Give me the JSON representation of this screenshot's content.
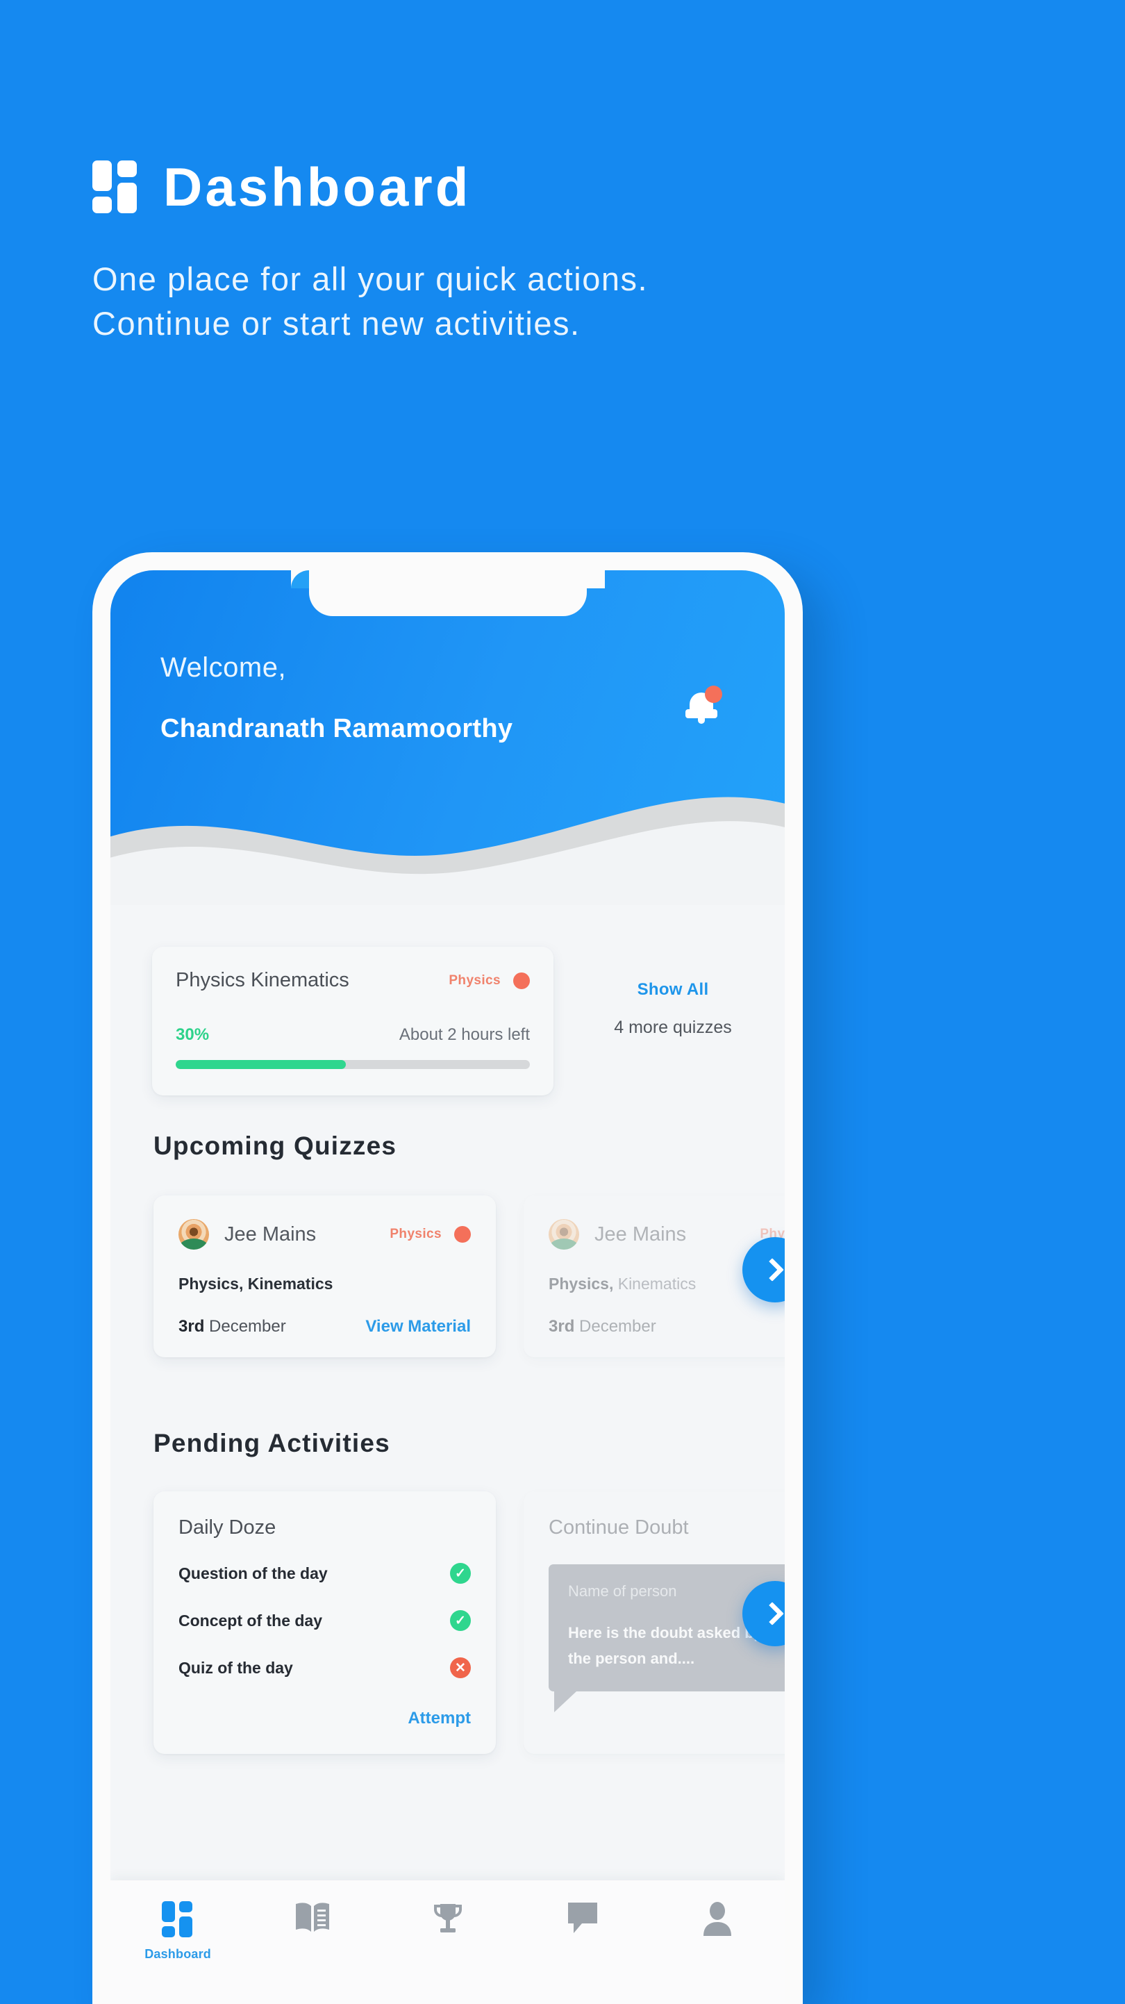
{
  "page": {
    "title": "Dashboard",
    "logo_icon": "dashboard-grid-icon",
    "subtitle_line1": "One place for all your quick actions.",
    "subtitle_line2": "Continue or start new activities.",
    "background_color": "#1589F0"
  },
  "phone": {
    "header": {
      "welcome_label": "Welcome,",
      "user_name": "Chandranath Ramamoorthy",
      "notification_icon": "bell-icon",
      "notification_dot_color": "#F4705A",
      "gradient_from": "#1183EE",
      "gradient_to": "#23A2FA"
    },
    "progress_card": {
      "title": "Physics Kinematics",
      "tag_label": "Physics",
      "tag_color": "#F0826C",
      "tag_dot_color": "#F4705A",
      "percent_label": "30%",
      "percent_value": 30,
      "bar_fill_percent": 48,
      "time_left": "About 2 hours left",
      "progress_color": "#2FD68E"
    },
    "show_all": {
      "link_label": "Show All",
      "count_label": "4 more quizzes",
      "link_color": "#1E95EA"
    },
    "upcoming": {
      "section_title": "Upcoming Quizzes",
      "next_icon": "chevron-right-icon",
      "cards": [
        {
          "avatar_icon": "jee-emblem-icon",
          "name": "Jee Mains",
          "tag_label": "Physics",
          "subject": "Physics, Kinematics",
          "date_bold": "3rd",
          "date_rest": " December",
          "action_label": "View Material"
        },
        {
          "avatar_icon": "jee-emblem-icon",
          "name": "Jee Mains",
          "tag_label": "Physics",
          "subject_bold": "Physics,",
          "subject_rest": " Kinematics",
          "date_bold": "3rd",
          "date_rest": " December"
        }
      ]
    },
    "pending": {
      "section_title": "Pending Activities",
      "next_icon": "chevron-right-icon",
      "daily_doze": {
        "title": "Daily Doze",
        "items": [
          {
            "label": "Question of the day",
            "status": "done",
            "icon": "check-circle-icon"
          },
          {
            "label": "Concept of the day",
            "status": "done",
            "icon": "check-circle-icon"
          },
          {
            "label": "Quiz of the day",
            "status": "pending",
            "icon": "cross-circle-icon"
          }
        ],
        "action_label": "Attempt",
        "done_color": "#2FD68E",
        "pending_color": "#F0654B"
      },
      "continue_doubt": {
        "title": "Continue Doubt",
        "bubble_name": "Name of person",
        "bubble_text": "Here is the doubt asked by the person and....",
        "bubble_color": "#7C848F"
      }
    },
    "tabbar": {
      "items": [
        {
          "icon": "dashboard-grid-icon",
          "label": "Dashboard",
          "active": true
        },
        {
          "icon": "book-icon",
          "label": "",
          "active": false
        },
        {
          "icon": "trophy-icon",
          "label": "",
          "active": false
        },
        {
          "icon": "chat-bubble-icon",
          "label": "",
          "active": false
        },
        {
          "icon": "person-icon",
          "label": "",
          "active": false
        }
      ],
      "active_color": "#1592F0",
      "inactive_color": "#9AA1A9"
    }
  }
}
